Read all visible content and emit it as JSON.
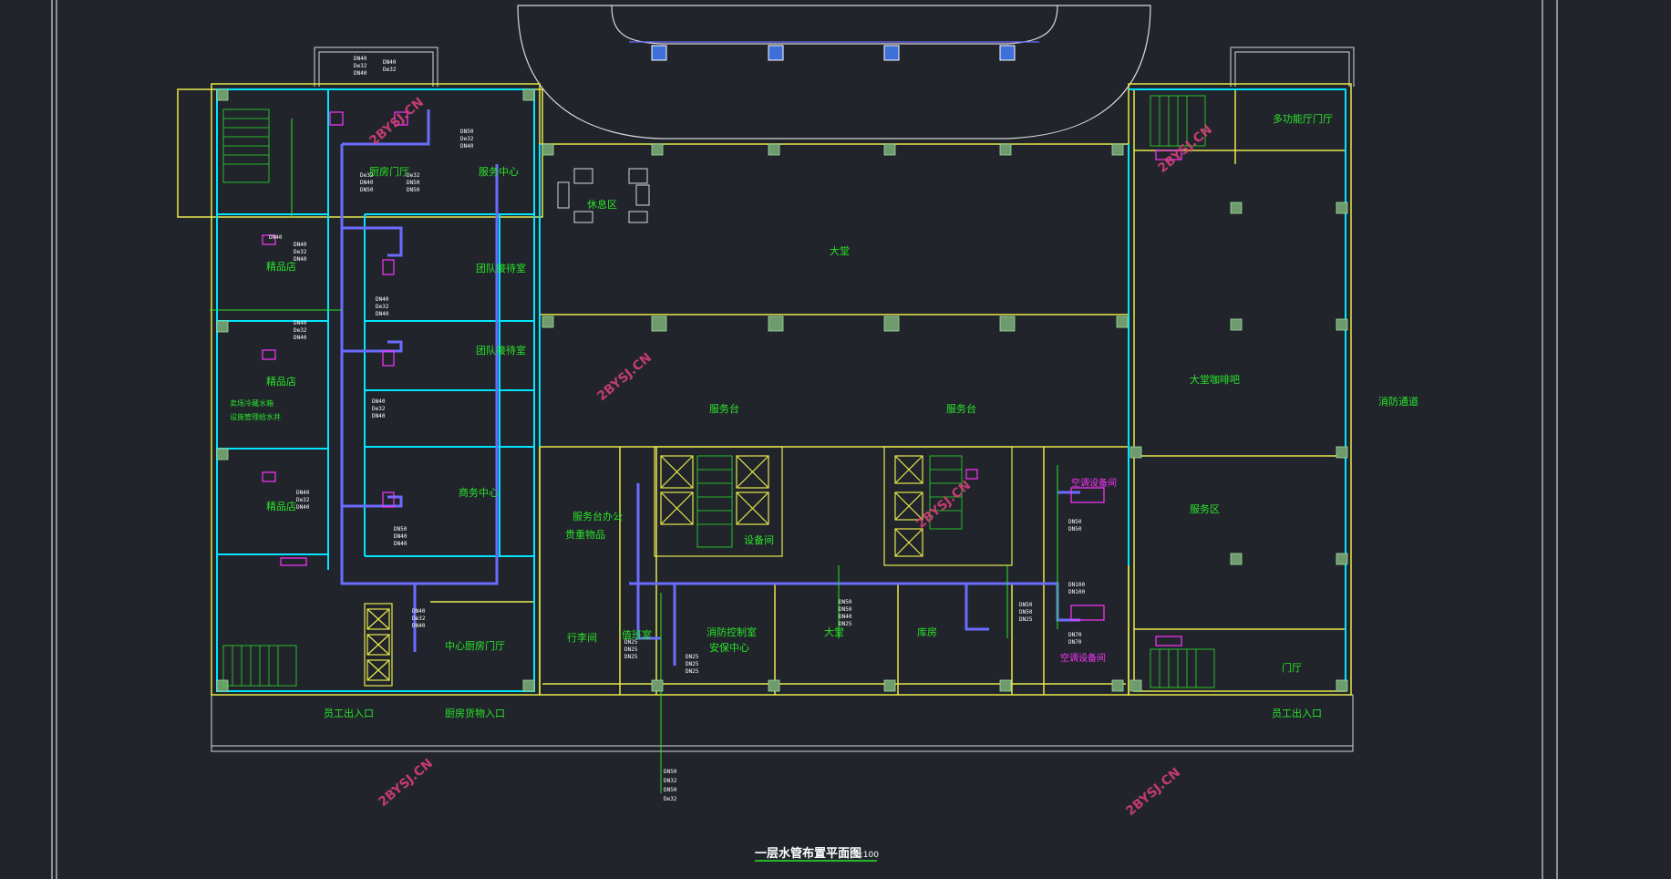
{
  "drawing": {
    "title": "一层水管布置平面图",
    "scale": "1:100"
  },
  "rooms": {
    "reception": "服务中心",
    "room2": "厨房门厅",
    "shop1": "精品店",
    "shop2": "精品店",
    "shop3": "精品店",
    "shop_note1": "卖场冷藏水箱",
    "shop_note2": "设施管理给水井",
    "group1": "团队接待室",
    "group2": "团队接待室",
    "business": "商务中心",
    "rest": "休息区",
    "lobby": "大堂",
    "service_desk1": "服务台",
    "service_desk2": "服务台",
    "lobby_bar": "大堂咖啡吧",
    "multi_hall": "多功能厅门厅",
    "fire_lane": "消防通道",
    "service_area": "服务区",
    "service_office": "服务台办公",
    "storage": "贵重物品",
    "luggage": "行李间",
    "duty": "值班室",
    "fire_ctrl": "消防控制室",
    "security": "安保中心",
    "lobby2": "大堂",
    "equip": "设备间",
    "ac_room1": "空调设备间",
    "ac_room2": "空调设备间",
    "storeroom": "库房",
    "hall": "门厅",
    "kitchen_hall": "中心厨房门厅",
    "staff_entry1": "员工出入口",
    "kitchen_entry": "厨房货物入口",
    "staff_entry2": "员工出入口",
    "wm_text": "2BYSJ.CN"
  },
  "pipes": {
    "dn40": "DN40",
    "de32": "De32",
    "dn50": "DN50",
    "dn25": "DN25",
    "dn32": "DN32",
    "dn100": "DN100",
    "dn70": "DN70"
  },
  "colors": {
    "background": "#21252b",
    "wall_yellow": "#e8e84a",
    "wall_cyan": "#00e5ff",
    "pipe_blue": "#6b6bff",
    "label_green": "#29e329",
    "magenta": "#ff33ff",
    "column": "#6e9a6e"
  }
}
